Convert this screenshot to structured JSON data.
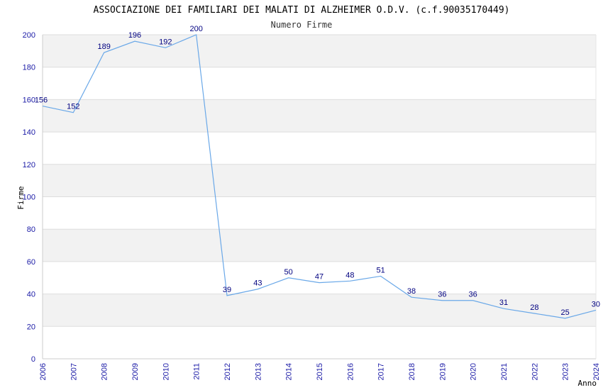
{
  "chart_data": {
    "type": "line",
    "title": "ASSOCIAZIONE DEI FAMILIARI DEI MALATI DI ALZHEIMER O.D.V. (c.f.90035170449)",
    "subtitle": "Numero Firme",
    "xlabel": "Anno",
    "ylabel": "Firme",
    "categories": [
      "2006",
      "2007",
      "2008",
      "2009",
      "2010",
      "2011",
      "2012",
      "2013",
      "2014",
      "2015",
      "2016",
      "2017",
      "2018",
      "2019",
      "2020",
      "2021",
      "2022",
      "2023",
      "2024"
    ],
    "values": [
      156,
      152,
      189,
      196,
      192,
      200,
      39,
      43,
      50,
      47,
      48,
      51,
      38,
      36,
      36,
      31,
      28,
      25,
      30
    ],
    "ylim": [
      0,
      200
    ],
    "yticks": [
      0,
      20,
      40,
      60,
      80,
      100,
      120,
      140,
      160,
      180,
      200
    ],
    "grid": true,
    "colors": {
      "line": "#6aa8e8",
      "band": "#f2f2f2",
      "grid": "#dddddd",
      "tick_text": "#1a1aa6",
      "label_text": "#000080"
    }
  }
}
